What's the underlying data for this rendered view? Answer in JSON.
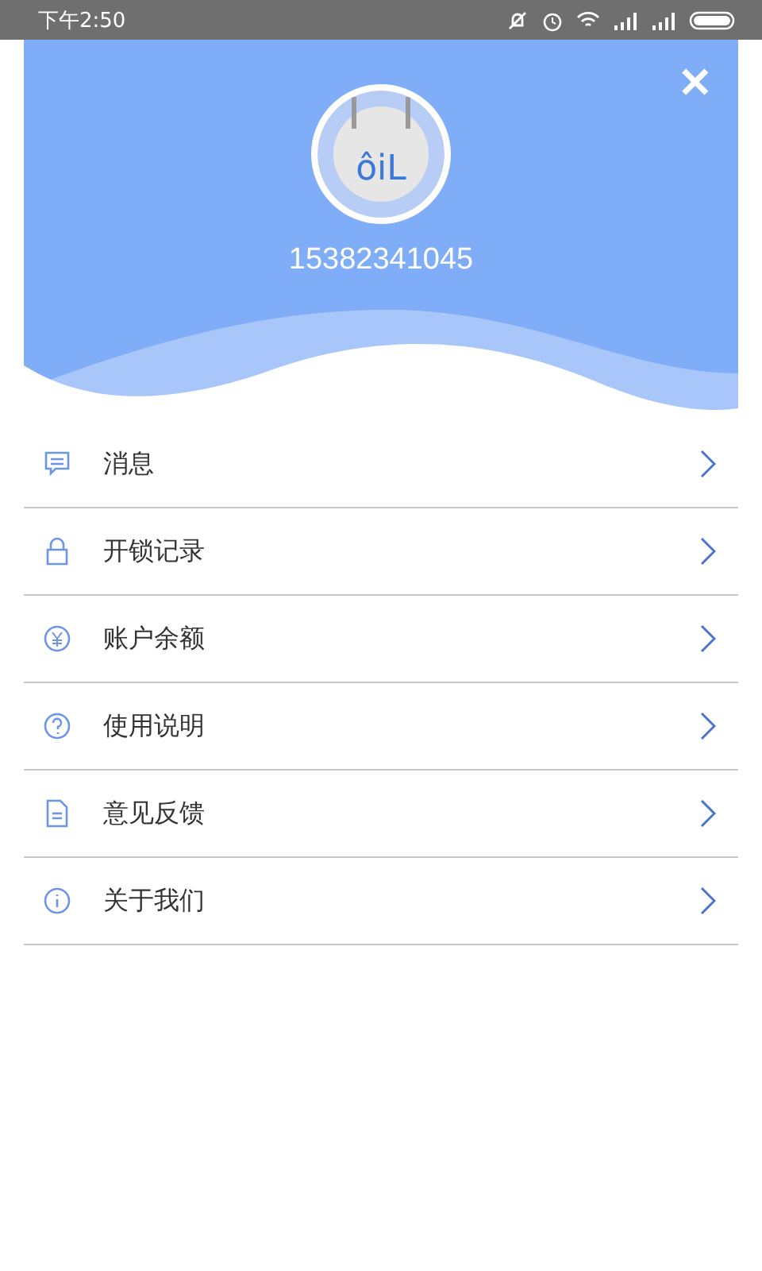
{
  "status_bar": {
    "time": "下午2:50"
  },
  "profile": {
    "logo_text": "ôiL",
    "phone": "15382341045"
  },
  "close": {
    "label": "✕"
  },
  "menu": [
    {
      "label": "消息"
    },
    {
      "label": "开锁记录"
    },
    {
      "label": "账户余额"
    },
    {
      "label": "使用说明"
    },
    {
      "label": "意见反馈"
    },
    {
      "label": "关于我们"
    }
  ]
}
